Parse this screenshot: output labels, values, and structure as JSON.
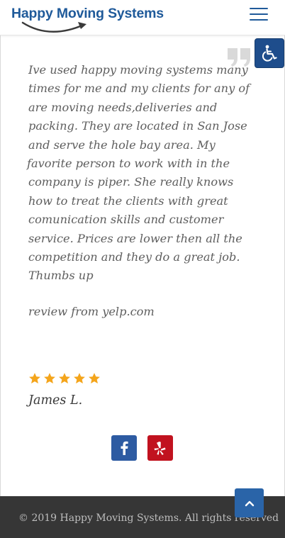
{
  "header": {
    "logo_text": "Happy Moving Systems",
    "menu_icon": "hamburger-menu-icon"
  },
  "accessibility": {
    "icon": "wheelchair-icon"
  },
  "testimonial": {
    "quote_icon": "quote-icon",
    "lines": [
      "Ive used happy moving systems many",
      "times for me and my clients for any of",
      "are moving needs,deliveries and",
      "packing. They are located in San Jose",
      "and serve the hole bay area. My",
      "favorite person to work with in the",
      "company is piper. She really knows",
      "how to treat the clients with great",
      "comunication skills and customer",
      "service. Prices are lower then all the",
      "competition and they do a great job.",
      "Thumbs up"
    ],
    "source": "review from yelp.com",
    "rating": 5,
    "author": "James L."
  },
  "social": {
    "facebook_icon": "facebook-icon",
    "yelp_icon": "yelp-icon"
  },
  "footer": {
    "copyright": "© 2019 Happy Moving Systems. All rights reserved",
    "scroll_top_icon": "chevron-up-icon"
  },
  "colors": {
    "brand_blue": "#1f5a9a",
    "star_gold": "#f4a51c",
    "facebook": "#2d5ba2",
    "yelp": "#c1121f",
    "footer_bg": "#363636"
  }
}
